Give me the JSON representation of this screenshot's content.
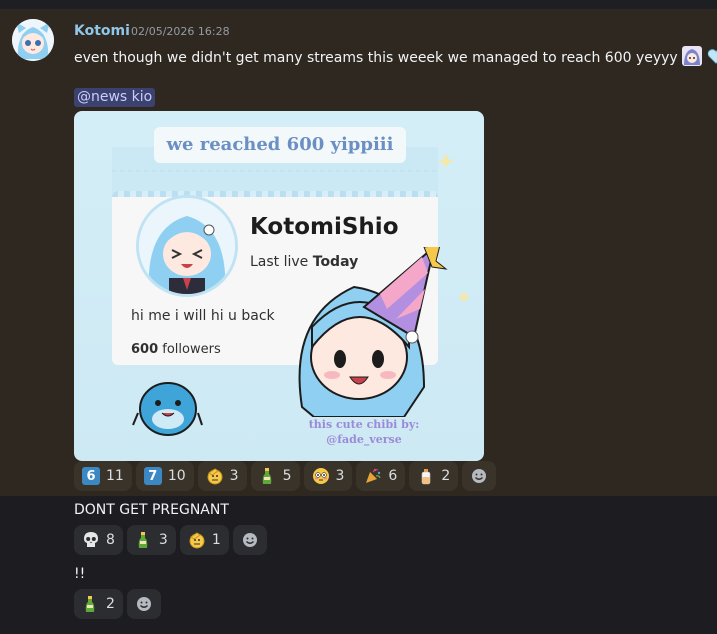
{
  "message": {
    "username": "Kotomi",
    "timestamp": "02/05/2026 16:28",
    "text": "even though we didn't get many streams this weeek we managed to reach 600 yeyyy",
    "mention": "@news kio",
    "image": {
      "banner": "we reached 600 yippiii",
      "profile_name": "KotomiShio",
      "last_live_prefix": "Last live",
      "last_live_value": "Today",
      "bio": "hi me i will hi u back",
      "followers_count": "600",
      "followers_label": "followers",
      "credit_line1": "this cute chibi by:",
      "credit_line2": "@fade_verse"
    },
    "reactions": [
      {
        "icon": "keycap-6-icon",
        "glyph": "6",
        "count": "11"
      },
      {
        "icon": "keycap-7-icon",
        "glyph": "7",
        "count": "10"
      },
      {
        "icon": "saluting-face-icon",
        "glyph": "🫡",
        "count": "3"
      },
      {
        "icon": "bottle-icon",
        "glyph": "🍾",
        "count": "5"
      },
      {
        "icon": "flushed-face-icon",
        "glyph": "😳",
        "count": "3"
      },
      {
        "icon": "party-popper-icon",
        "glyph": "🎉",
        "count": "6"
      },
      {
        "icon": "baby-bottle-icon",
        "glyph": "🍼",
        "count": "2"
      }
    ]
  },
  "followups": [
    {
      "text": "DONT GET PREGNANT",
      "reactions": [
        {
          "icon": "skull-icon",
          "glyph": "💀",
          "count": "8"
        },
        {
          "icon": "bottle-icon",
          "glyph": "🍾",
          "count": "3"
        },
        {
          "icon": "saluting-face-icon",
          "glyph": "🫡",
          "count": "1"
        }
      ]
    },
    {
      "text": "!!",
      "reactions": [
        {
          "icon": "bottle-icon",
          "glyph": "🍾",
          "count": "2"
        }
      ]
    }
  ],
  "colors": {
    "username": "#8fc7ea",
    "mention_bg": "#3c4270",
    "banner_text": "#6b8fc2",
    "credit_text": "#9b8ad8"
  }
}
